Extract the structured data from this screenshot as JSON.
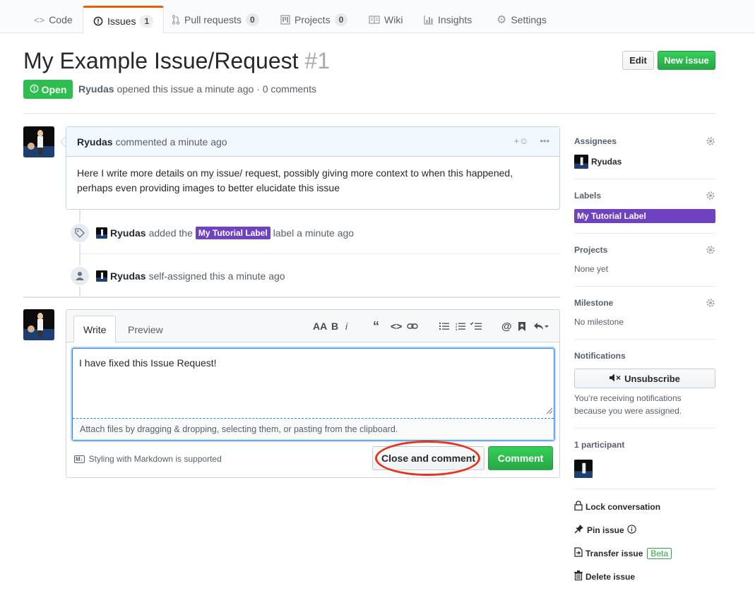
{
  "tabs": [
    {
      "label": "Code",
      "icon": "code-icon"
    },
    {
      "label": "Issues",
      "count": "1",
      "icon": "issue-opened-icon"
    },
    {
      "label": "Pull requests",
      "count": "0",
      "icon": "git-pull-request-icon"
    },
    {
      "label": "Projects",
      "count": "0",
      "icon": "project-icon"
    },
    {
      "label": "Wiki",
      "icon": "book-icon"
    },
    {
      "label": "Insights",
      "icon": "graph-icon"
    },
    {
      "label": "Settings",
      "icon": "gear-icon"
    }
  ],
  "issue": {
    "title": "My Example Issue/Request",
    "number": "#1",
    "state": "Open",
    "author": "Ryudas",
    "meta": "opened this issue a minute ago · 0 comments",
    "edit_label": "Edit",
    "new_issue_label": "New issue"
  },
  "comment": {
    "author": "Ryudas",
    "time": "commented a minute ago",
    "body": "Here I write more details on my issue/ request, possibly giving more context to when this happened, perhaps even providing images to better elucidate this issue"
  },
  "events": [
    {
      "user": "Ryudas",
      "pre": "added the",
      "label": "My Tutorial Label",
      "post": "label a minute ago"
    },
    {
      "user": "Ryudas",
      "text": "self-assigned this a minute ago"
    }
  ],
  "form": {
    "tab_write": "Write",
    "tab_preview": "Preview",
    "text": "I have fixed this Issue Request!",
    "attach_hint": "Attach files by dragging & dropping, selecting them, or pasting from the clipboard.",
    "markdown_note": "Styling with Markdown is supported",
    "close_label": "Close and comment",
    "comment_label": "Comment"
  },
  "sidebar": {
    "assignees_title": "Assignees",
    "assignee": "Ryudas",
    "labels_title": "Labels",
    "label": "My Tutorial Label",
    "label_color": "#6f42c1",
    "projects_title": "Projects",
    "projects_value": "None yet",
    "milestone_title": "Milestone",
    "milestone_value": "No milestone",
    "notifications_title": "Notifications",
    "unsubscribe_label": "Unsubscribe",
    "notif_reason_1": "You’re receiving notifications",
    "notif_reason_2": "because you were assigned.",
    "participants": "1 participant",
    "lock": "Lock conversation",
    "pin": "Pin issue",
    "transfer": "Transfer issue",
    "beta": "Beta",
    "delete": "Delete issue"
  },
  "colors": {
    "open_green": "#2cbe4e",
    "primary_green": "#28a745",
    "tab_accent": "#e36209",
    "highlight_red": "#e8341c"
  }
}
